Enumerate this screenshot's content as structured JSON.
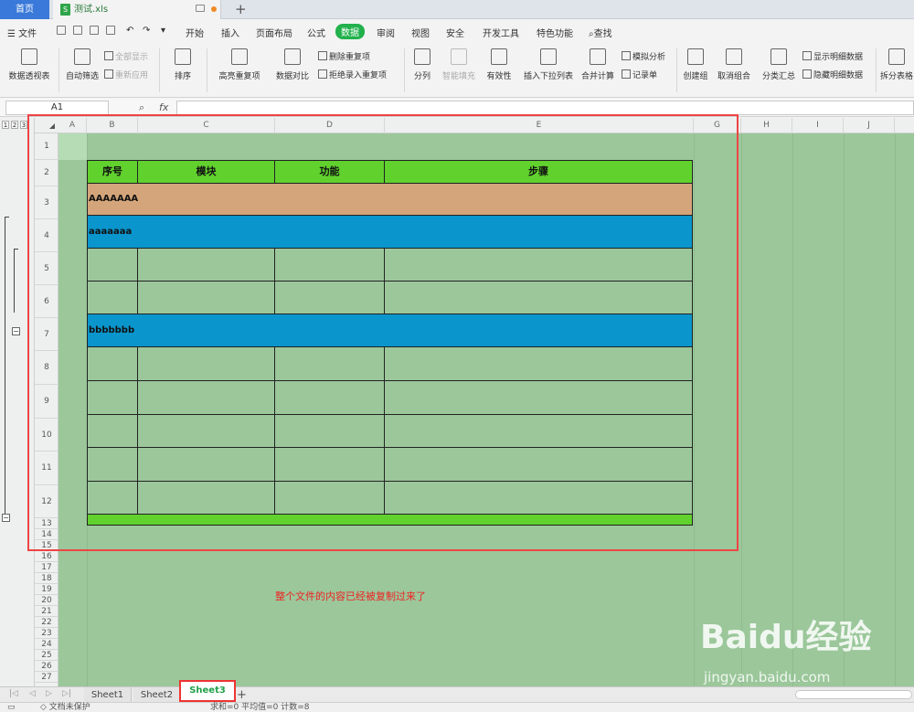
{
  "tabs": {
    "home": "首页",
    "file_name": "测试.xls",
    "new_tab": "+"
  },
  "menu": {
    "file": "文件",
    "items": [
      "开始",
      "插入",
      "页面布局",
      "公式",
      "数据",
      "审阅",
      "视图",
      "安全",
      "开发工具",
      "特色功能"
    ],
    "active": "数据",
    "search": "查找"
  },
  "ribbon": {
    "pivot": "数据透视表",
    "autofilter": "自动筛选",
    "show_all": "全部显示",
    "reapply": "重新应用",
    "sort": "排序",
    "highlight_dup": "高亮重复项",
    "compare": "数据对比",
    "remove_dup": "删除重复项",
    "reject_dup": "拒绝录入重复项",
    "split": "分列",
    "smart_fill": "智能填充",
    "validity": "有效性",
    "dropdown": "插入下拉列表",
    "consolidate": "合并计算",
    "simulate": "模拟分析",
    "record": "记录单",
    "create_group": "创建组",
    "ungroup": "取消组合",
    "subtotal": "分类汇总",
    "show_detail": "显示明细数据",
    "hide_detail": "隐藏明细数据",
    "split_table": "拆分表格"
  },
  "formula_bar": {
    "name_box": "A1",
    "fx": "fx"
  },
  "columns": [
    "A",
    "B",
    "C",
    "D",
    "E",
    "G",
    "H",
    "I",
    "J"
  ],
  "outline_levels": [
    "1",
    "2",
    "3"
  ],
  "rows": [
    "1",
    "2",
    "3",
    "4",
    "5",
    "6",
    "7",
    "8",
    "9",
    "10",
    "11",
    "12",
    "13",
    "14",
    "15",
    "16",
    "17",
    "18",
    "19",
    "20",
    "21",
    "22",
    "23",
    "24",
    "25",
    "26",
    "27"
  ],
  "table": {
    "headers": [
      "序号",
      "模块",
      "功能",
      "步骤"
    ],
    "row3": "AAAAAAA",
    "row4": "aaaaaaa",
    "row7": "bbbbbbb"
  },
  "note": "整个文件的内容已经被复制过来了",
  "sheets": [
    "Sheet1",
    "Sheet2",
    "Sheet3"
  ],
  "active_sheet": "Sheet3",
  "status": {
    "protect": "文档未保护",
    "stats": "求和=0  平均值=0  计数=8"
  },
  "watermark": {
    "brand": "Baidu",
    "cn": "经验",
    "url": "jingyan.baidu.com"
  },
  "colors": {
    "header_green": "#61d12e",
    "tan": "#d4a57a",
    "blue": "#0a95cc",
    "sheet_bg": "#9bc79b",
    "highlight": "#ee4444"
  }
}
